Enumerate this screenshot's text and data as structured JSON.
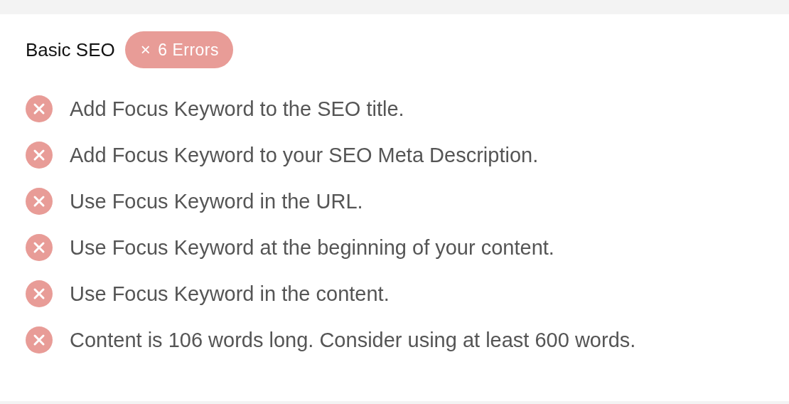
{
  "section": {
    "title": "Basic SEO",
    "badge": {
      "icon": "×",
      "label": "6 Errors"
    }
  },
  "checks": [
    {
      "kind": "error",
      "text": "Add Focus Keyword to the SEO title."
    },
    {
      "kind": "error",
      "text": "Add Focus Keyword to your SEO Meta Description."
    },
    {
      "kind": "error",
      "text": "Use Focus Keyword in the URL."
    },
    {
      "kind": "error",
      "text": "Use Focus Keyword at the beginning of your content."
    },
    {
      "kind": "error",
      "text": "Use Focus Keyword in the content."
    },
    {
      "kind": "error",
      "text": "Content is 106 words long. Consider using at least 600 words."
    }
  ]
}
